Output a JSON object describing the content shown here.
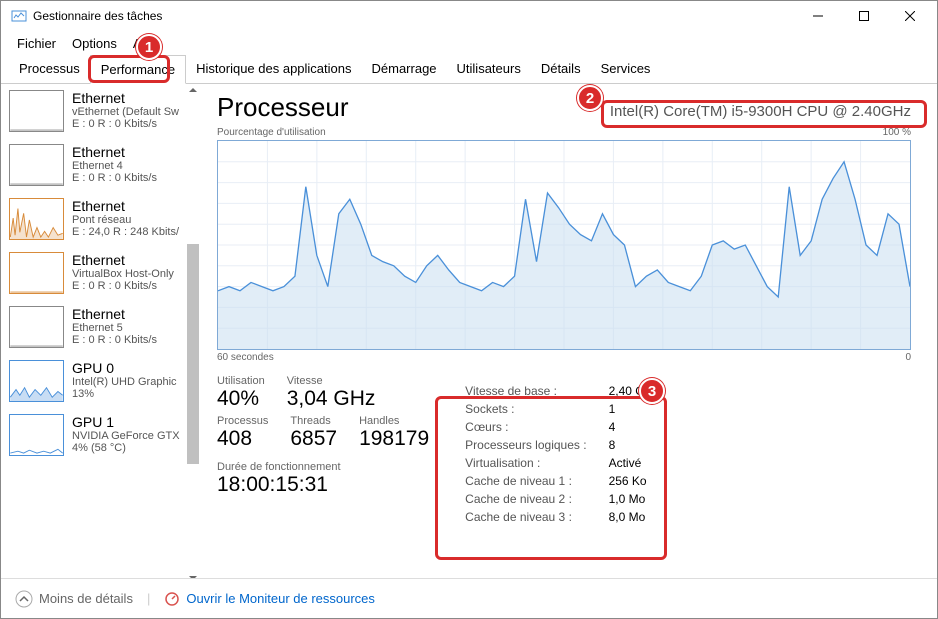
{
  "window": {
    "title": "Gestionnaire des tâches"
  },
  "menu": {
    "file": "Fichier",
    "options": "Options",
    "view": "Affic"
  },
  "tabs": {
    "processes": "Processus",
    "performance": "Performance",
    "app_history": "Historique des applications",
    "startup": "Démarrage",
    "users": "Utilisateurs",
    "details": "Détails",
    "services": "Services"
  },
  "sidebar": [
    {
      "name": "Ethernet",
      "sub1": "vEthernet (Default Sw",
      "sub2": "E : 0 R : 0 Kbits/s",
      "thumb": "flat",
      "color": "#888"
    },
    {
      "name": "Ethernet",
      "sub1": "Ethernet 4",
      "sub2": "E : 0 R : 0 Kbits/s",
      "thumb": "flat",
      "color": "#888"
    },
    {
      "name": "Ethernet",
      "sub1": "Pont réseau",
      "sub2": "E : 24,0 R : 248 Kbits/",
      "thumb": "spiky",
      "color": "#d88b3a"
    },
    {
      "name": "Ethernet",
      "sub1": "VirtualBox Host-Only",
      "sub2": "E : 0 R : 0 Kbits/s",
      "thumb": "flat",
      "color": "#d88b3a"
    },
    {
      "name": "Ethernet",
      "sub1": "Ethernet 5",
      "sub2": "E : 0 R : 0 Kbits/s",
      "thumb": "flat",
      "color": "#888"
    },
    {
      "name": "GPU 0",
      "sub1": "Intel(R) UHD Graphic",
      "sub2": "13%",
      "thumb": "wavy",
      "color": "#4a90d9"
    },
    {
      "name": "GPU 1",
      "sub1": "NVIDIA GeForce GTX",
      "sub2": "4% (58 °C)",
      "thumb": "lowwavy",
      "color": "#4a90d9"
    }
  ],
  "main": {
    "title": "Processeur",
    "cpu_name": "Intel(R) Core(TM) i5-9300H CPU @ 2.40GHz",
    "chart_top_left": "Pourcentage d'utilisation",
    "chart_top_right": "100 %",
    "chart_bottom_left": "60 secondes",
    "chart_bottom_right": "0",
    "stats": {
      "util_label": "Utilisation",
      "util_value": "40%",
      "speed_label": "Vitesse",
      "speed_value": "3,04 GHz",
      "proc_label": "Processus",
      "proc_value": "408",
      "threads_label": "Threads",
      "threads_value": "6857",
      "handles_label": "Handles",
      "handles_value": "198179",
      "uptime_label": "Durée de fonctionnement",
      "uptime_value": "18:00:15:31"
    },
    "details": {
      "base_speed_l": "Vitesse de base :",
      "base_speed_v": "2,40 GHz",
      "sockets_l": "Sockets :",
      "sockets_v": "1",
      "cores_l": "Cœurs :",
      "cores_v": "4",
      "logical_l": "Processeurs logiques :",
      "logical_v": "8",
      "virt_l": "Virtualisation :",
      "virt_v": "Activé",
      "l1_l": "Cache de niveau 1 :",
      "l1_v": "256 Ko",
      "l2_l": "Cache de niveau 2 :",
      "l2_v": "1,0 Mo",
      "l3_l": "Cache de niveau 3 :",
      "l3_v": "8,0 Mo"
    }
  },
  "footer": {
    "less": "Moins de détails",
    "monitor": "Ouvrir le Moniteur de ressources"
  },
  "annotations": {
    "a1": "1",
    "a2": "2",
    "a3": "3"
  },
  "chart_data": {
    "type": "line",
    "title": "Pourcentage d'utilisation",
    "xlabel": "60 secondes",
    "ylabel": "",
    "ylim": [
      0,
      100
    ],
    "x_range_seconds": [
      60,
      0
    ],
    "values": [
      28,
      30,
      28,
      32,
      30,
      28,
      30,
      35,
      78,
      45,
      30,
      65,
      72,
      60,
      45,
      42,
      40,
      35,
      32,
      40,
      45,
      38,
      32,
      30,
      28,
      32,
      30,
      35,
      72,
      42,
      75,
      68,
      60,
      55,
      52,
      65,
      55,
      50,
      30,
      35,
      38,
      32,
      30,
      28,
      35,
      50,
      52,
      48,
      50,
      40,
      30,
      25,
      78,
      45,
      52,
      72,
      82,
      90,
      72,
      50,
      45,
      65,
      60,
      30
    ]
  }
}
